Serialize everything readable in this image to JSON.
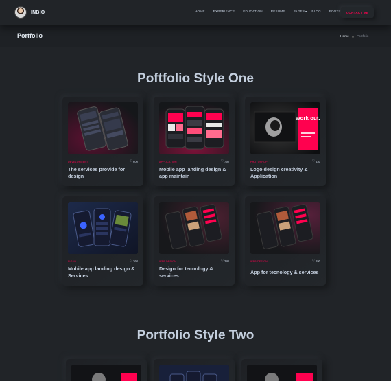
{
  "header": {
    "brand": "INBIO",
    "nav": [
      "HOME",
      "EXPERIENCE",
      "EDUCATION",
      "RESUME",
      "PAGES",
      "BLOG",
      "FOOTER"
    ],
    "contact_label": "CONTACT ME"
  },
  "breadcrumb": {
    "title": "Portfolio",
    "home": "Home",
    "current": "Portfolio"
  },
  "sections": {
    "style_one_title": "Poftfolio Style One",
    "style_two_title": "Portfolio Style Two"
  },
  "cards": [
    {
      "category": "DEVELOPMENT",
      "likes": "600",
      "title": "The services provide for design"
    },
    {
      "category": "APPLICATION",
      "likes": "750",
      "title": "Mobile app landing design & app maintain"
    },
    {
      "category": "PHOTOSHOP",
      "likes": "630",
      "title": "Logo design creativity & Application"
    },
    {
      "category": "FIGMA",
      "likes": "360",
      "title": "Mobile app landing design & Services"
    },
    {
      "category": "WEB DESIGN",
      "likes": "280",
      "title": "Design for tecnology & services"
    },
    {
      "category": "WEB DESIGN",
      "likes": "690",
      "title": "App for tecnology & services"
    }
  ],
  "thumb_text": {
    "workout": "work out."
  },
  "colors": {
    "accent": "#ff014f",
    "background": "#212428",
    "text": "#c4cfde"
  }
}
